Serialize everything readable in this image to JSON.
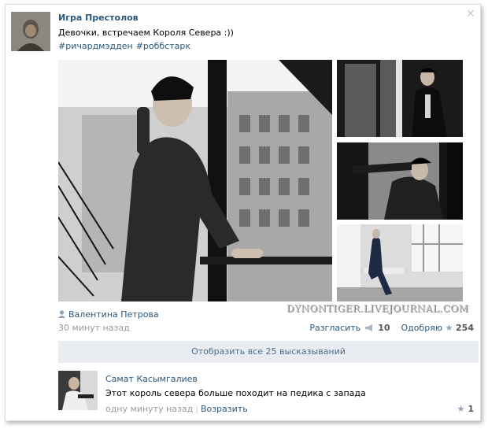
{
  "post": {
    "author": "Игра Престолов",
    "text": "Девочки, встречаем Короля Севера :))",
    "tags": [
      "#ричардмэдден",
      "#роббстарк"
    ],
    "watermark": "DYNONTIGER.LIVEJOURNAL.COM",
    "shared_by": "Валентина Петрова",
    "time": "30 минут назад",
    "share_label": "Разгласить",
    "share_count": "10",
    "like_label": "Одобряю",
    "like_count": "254"
  },
  "comments_toggle": "Отобразить все 25 высказываний",
  "comment": {
    "author": "Самат Касымгалиев",
    "text": "Этот король севера больше походит на педика с запада",
    "time": "одну минуту назад",
    "separator": "|",
    "reply_label": "Возразить",
    "like_count": "1"
  },
  "icons": {
    "close": "close-icon",
    "user": "user-icon",
    "megaphone": "megaphone-icon",
    "star": "star-icon"
  }
}
